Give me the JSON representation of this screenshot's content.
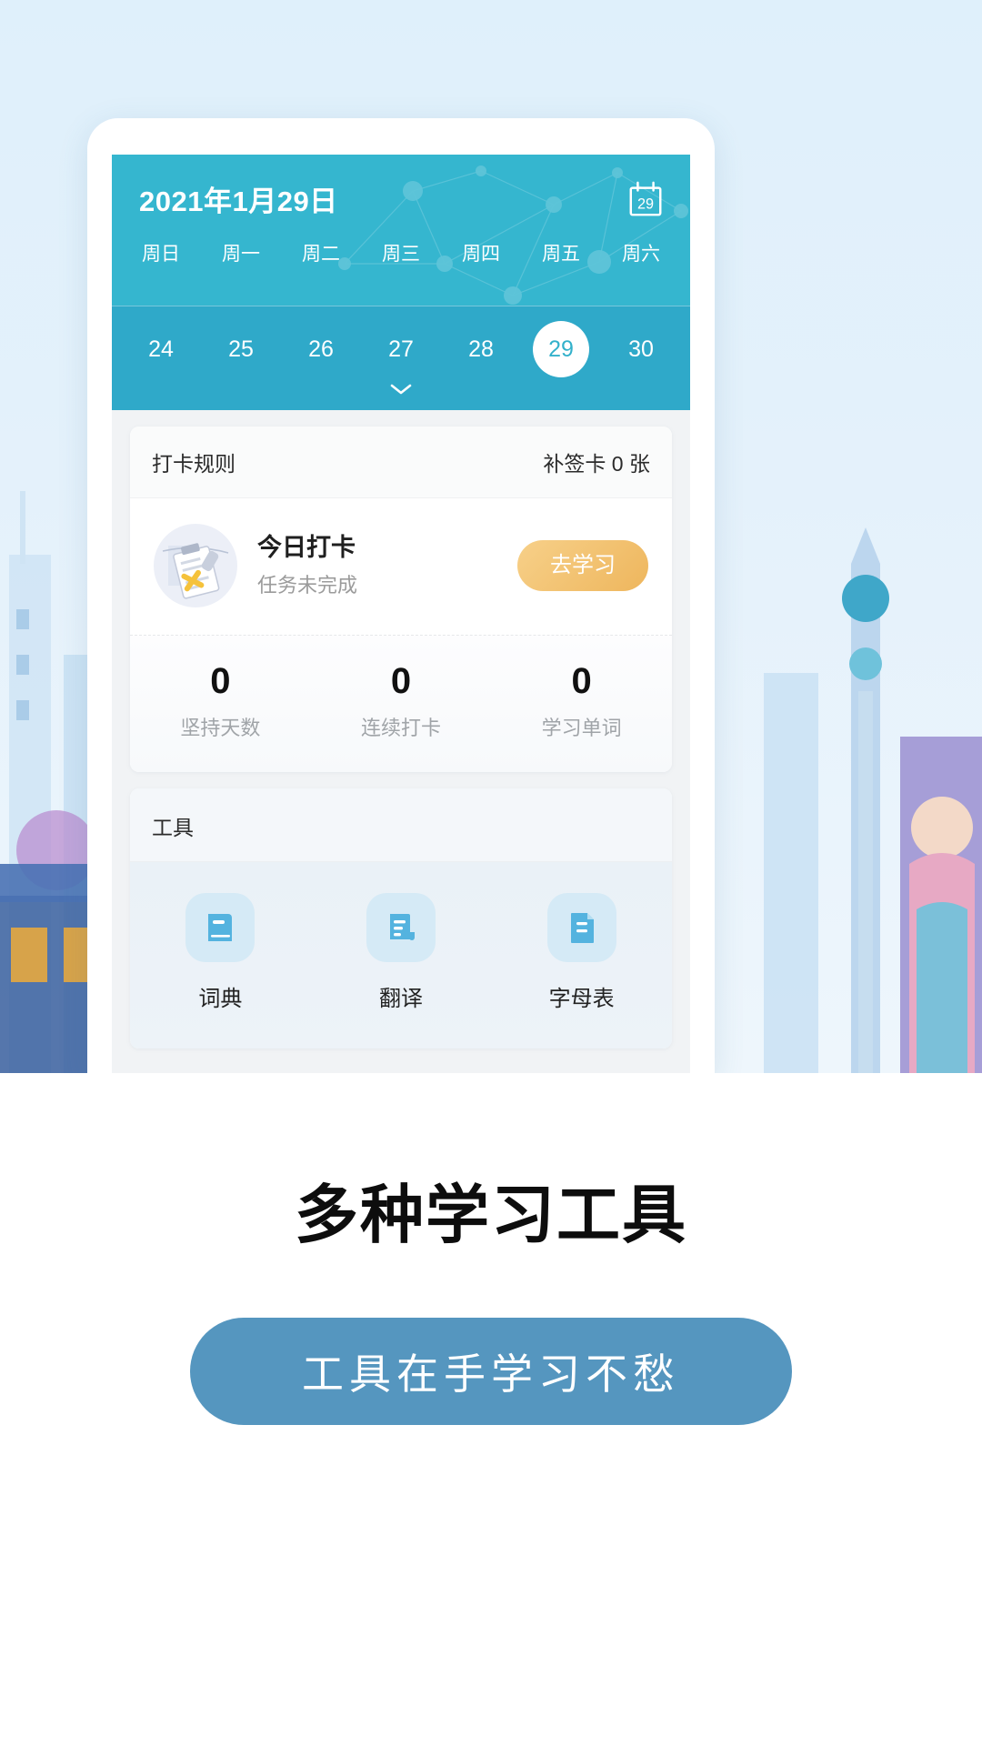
{
  "app": {
    "calendar": {
      "title": "2021年1月29日",
      "calendar_icon_day": "29",
      "weekdays": [
        "周日",
        "周一",
        "周二",
        "周三",
        "周四",
        "周五",
        "周六"
      ],
      "dates": [
        "24",
        "25",
        "26",
        "27",
        "28",
        "29",
        "30"
      ],
      "selected_date": "29",
      "expand_icon": "chevron-down-icon",
      "header_color": "#35b6cf",
      "dates_row_color": "#2fa9c9"
    },
    "checkin_card": {
      "header_left": "打卡规则",
      "header_right": "补签卡 0 张",
      "title": "今日打卡",
      "subtitle": "任务未完成",
      "action_label": "去学习",
      "action_color": "#eeb65d",
      "stats": [
        {
          "value": "0",
          "label": "坚持天数"
        },
        {
          "value": "0",
          "label": "连续打卡"
        },
        {
          "value": "0",
          "label": "学习单词"
        }
      ]
    },
    "tools_card": {
      "header": "工具",
      "items": [
        {
          "label": "词典",
          "icon": "book-icon"
        },
        {
          "label": "翻译",
          "icon": "translate-document-icon"
        },
        {
          "label": "字母表",
          "icon": "file-text-icon"
        }
      ],
      "icon_color": "#54b3df",
      "icon_bg": "#d5eaf6"
    }
  },
  "promo": {
    "headline": "多种学习工具",
    "pill_label": "工具在手学习不愁",
    "pill_color": "#5596bf"
  }
}
